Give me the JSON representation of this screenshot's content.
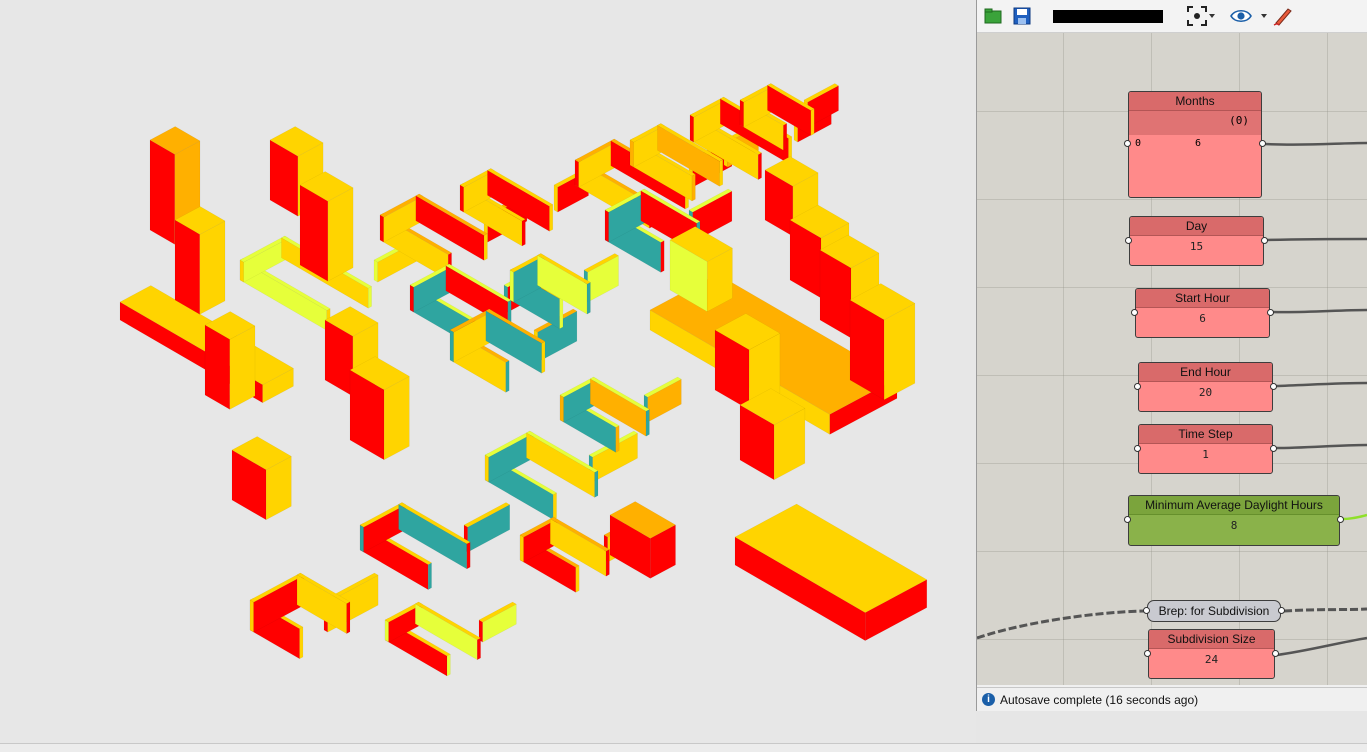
{
  "grasshopper": {
    "components": [
      {
        "id": "months",
        "title": "Months",
        "range_label": "(0)",
        "min_label": "0",
        "value": "6"
      },
      {
        "id": "day",
        "title": "Day",
        "value": "15"
      },
      {
        "id": "start-hour",
        "title": "Start Hour",
        "value": "6"
      },
      {
        "id": "end-hour",
        "title": "End Hour",
        "value": "20"
      },
      {
        "id": "time-step",
        "title": "Time Step",
        "value": "1"
      },
      {
        "id": "min-daylight",
        "title": "Minimum Average Daylight Hours",
        "value": "8"
      },
      {
        "id": "brep",
        "title": "Brep: for Subdivision"
      },
      {
        "id": "subdiv",
        "title": "Subdivision Size",
        "value": "24"
      }
    ],
    "status": "Autosave complete (16 seconds ago)"
  },
  "colors": {
    "high": "#ff0000",
    "mid": "#ffd400",
    "midhigh": "#ffb000",
    "low": "#e6ff3a",
    "cool": "#2fa5a0",
    "shadow": "#555555"
  },
  "icons": [
    "open-file-icon",
    "save-file-icon",
    "zoom-extents-icon",
    "preview-eye-icon",
    "sketch-pen-icon",
    "params-tab-icon",
    "maths-tab-icon",
    "sets-tab-icon",
    "vector-tab-icon",
    "surface-tab-icon",
    "info-icon"
  ]
}
